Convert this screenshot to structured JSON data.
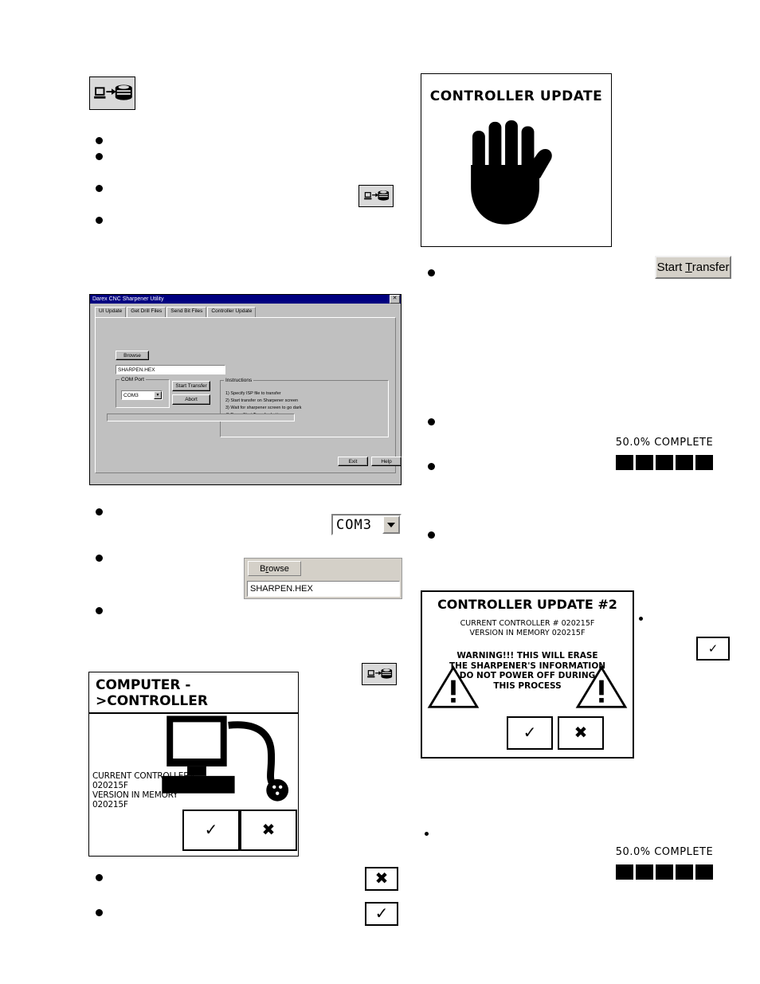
{
  "icons": {
    "transfer_icon": "computer-to-controller-transfer-icon",
    "check": "✓",
    "cross": "✖"
  },
  "sharpener_screen_1": {
    "title": "CONTROLLER UPDATE",
    "graphic": "stop-hand-icon"
  },
  "start_transfer_button": {
    "label_pre": "Start ",
    "label_accel": "T",
    "label_post": "ransfer",
    "label_full": "Start Transfer"
  },
  "progress_1": {
    "label": "50.0% COMPLETE",
    "blocks": 5
  },
  "progress_2": {
    "label": "50.0% COMPLETE",
    "blocks": 5
  },
  "utility_window": {
    "title": "Darex CNC Sharpener Utility",
    "close_label": "✕",
    "tabs": [
      {
        "label": "UI Update",
        "active": false
      },
      {
        "label": "Get Drill Files",
        "active": false
      },
      {
        "label": "Send Bit Files",
        "active": false
      },
      {
        "label": "Controller Update",
        "active": true
      }
    ],
    "browse_button": "Browse",
    "file_field": "SHARPEN.HEX",
    "com_group_label": "COM Port",
    "com_value": "COM3",
    "start_transfer": "Start Transfer",
    "abort": "Abort",
    "instructions_label": "Instructions",
    "instructions": [
      "1) Specify ISP file to transfer",
      "2) Start transfer on Sharpener screen",
      "3) Wait for sharpener screen to go dark",
      "4) Press Start Transfer button"
    ],
    "exit": "Exit",
    "help": "Help"
  },
  "com_combo_large": {
    "value": "COM3"
  },
  "browse_panel": {
    "button_pre": "B",
    "button_accel": "r",
    "button_post": "owse",
    "button_full": "Browse",
    "file_value": "SHARPEN.HEX"
  },
  "computer_controller_screen": {
    "title": "COMPUTER ->CONTROLLER",
    "line1": "CURRENT CONTROLLER#",
    "line2": "020215F",
    "line3": "VERSION IN MEMORY",
    "line4": "020215F",
    "accept_label": "✓",
    "cancel_label": "✖",
    "graphic": "computer-with-cable-icon"
  },
  "controller_update_2": {
    "title": "CONTROLLER UPDATE #2",
    "line1": "CURRENT CONTROLLER # 020215F",
    "line2": "VERSION IN MEMORY  020215F",
    "warning_lines": [
      "WARNING!!! THIS WILL ERASE",
      "THE SHARPENER'S INFORMATION",
      "DO NOT POWER OFF DURING",
      "THIS PROCESS"
    ],
    "warn_symbol": "!",
    "accept_label": "✓",
    "cancel_label": "✖"
  },
  "standalone_buttons": {
    "cross": "✖",
    "check": "✓",
    "check_right": "✓"
  }
}
